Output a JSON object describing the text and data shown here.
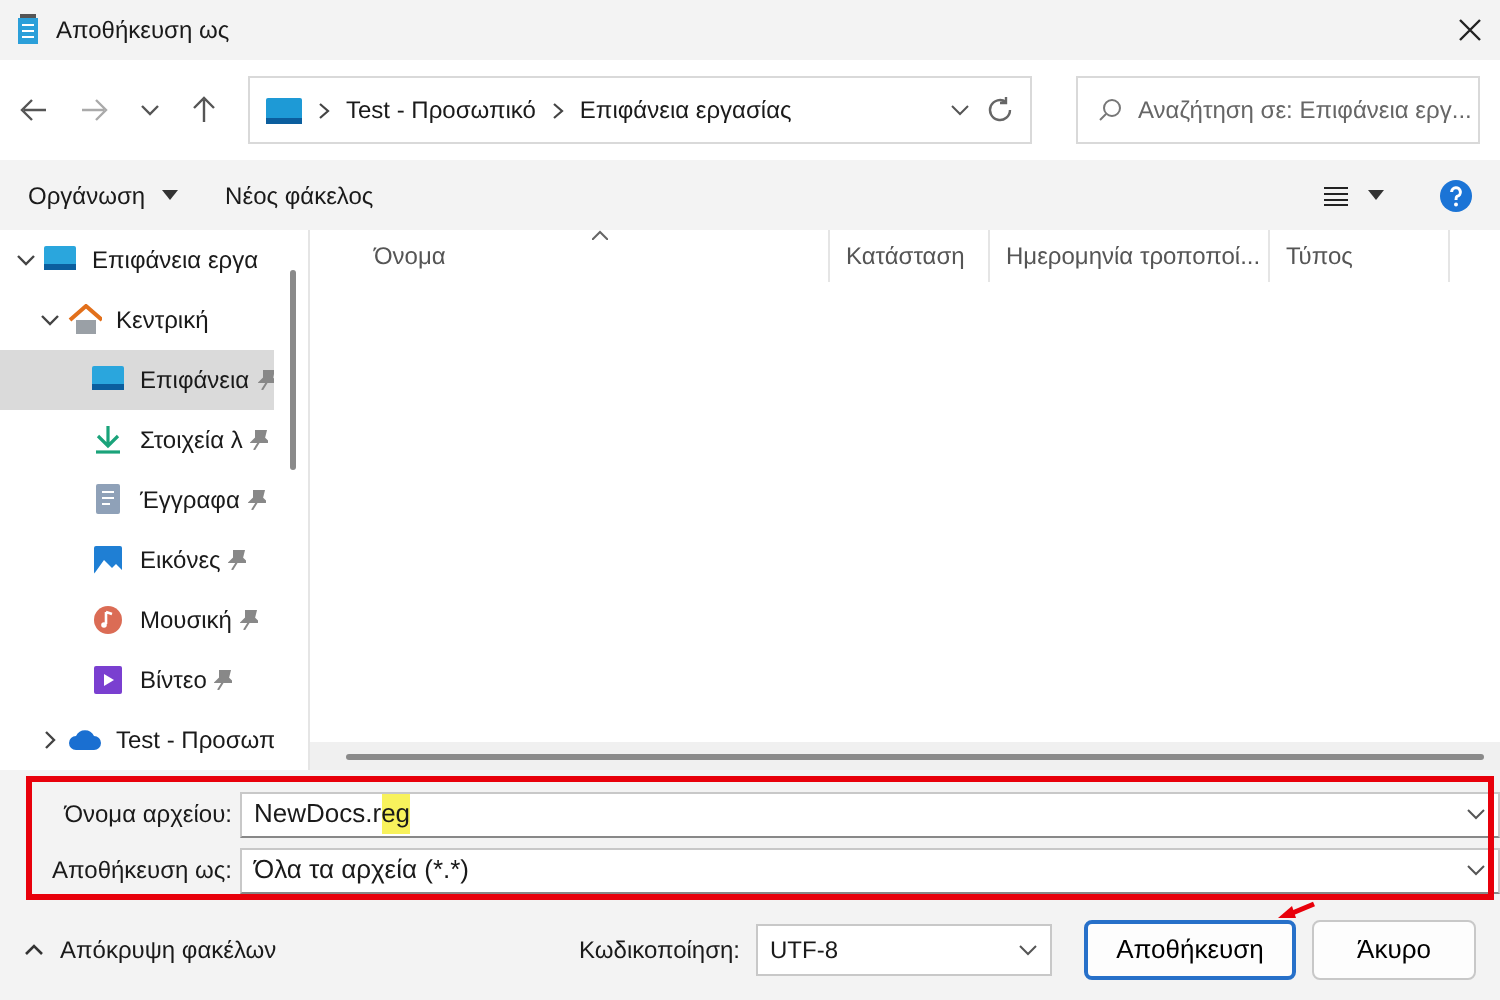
{
  "window": {
    "title": "Αποθήκευση ως"
  },
  "address_bar": {
    "segments": [
      "Test - Προσωπικό",
      "Επιφάνεια εργασίας"
    ]
  },
  "search": {
    "placeholder": "Αναζήτηση σε: Επιφάνεια εργ..."
  },
  "toolbar": {
    "organize": "Οργάνωση",
    "new_folder": "Νέος φάκελος"
  },
  "sidebar": {
    "items": [
      {
        "label": "Επιφάνεια εργα",
        "kind": "desktop",
        "expanded": true,
        "selected": false,
        "children": [
          {
            "label": "Κεντρική",
            "kind": "home",
            "expanded": true,
            "selected": false,
            "children": [
              {
                "label": "Επιφάνεια",
                "kind": "desktop",
                "pinned": true,
                "selected": true
              },
              {
                "label": "Στοιχεία λ",
                "kind": "download",
                "pinned": true,
                "selected": false
              },
              {
                "label": "Έγγραφα",
                "kind": "document",
                "pinned": true,
                "selected": false
              },
              {
                "label": "Εικόνες",
                "kind": "pictures",
                "pinned": true,
                "selected": false
              },
              {
                "label": "Μουσική",
                "kind": "music",
                "pinned": true,
                "selected": false
              },
              {
                "label": "Βίντεο",
                "kind": "video",
                "pinned": true,
                "selected": false
              }
            ]
          },
          {
            "label": "Test - Προσωπ",
            "kind": "cloud",
            "expanded": false,
            "selected": false
          }
        ]
      }
    ]
  },
  "table": {
    "columns": [
      "Όνομα",
      "Κατάσταση",
      "Ημερομηνία τροποποί...",
      "Τύπος"
    ]
  },
  "fields": [
    {
      "label": "Όνομα αρχείου:",
      "value": "NewDocs.r",
      "highlight": "eg"
    },
    {
      "label": "Αποθήκευση ως:",
      "value": "Όλα τα αρχεία  (*.*)"
    }
  ],
  "footer": {
    "hide_folders": "Απόκρυψη φακέλων",
    "encoding_label": "Κωδικοποίηση:",
    "encoding": "UTF-8",
    "save": "Αποθήκευση",
    "cancel": "Άκυρο"
  },
  "annotation_box": {
    "color": "#e8000b"
  },
  "annotation_arrow": {
    "color": "#e8000b"
  }
}
